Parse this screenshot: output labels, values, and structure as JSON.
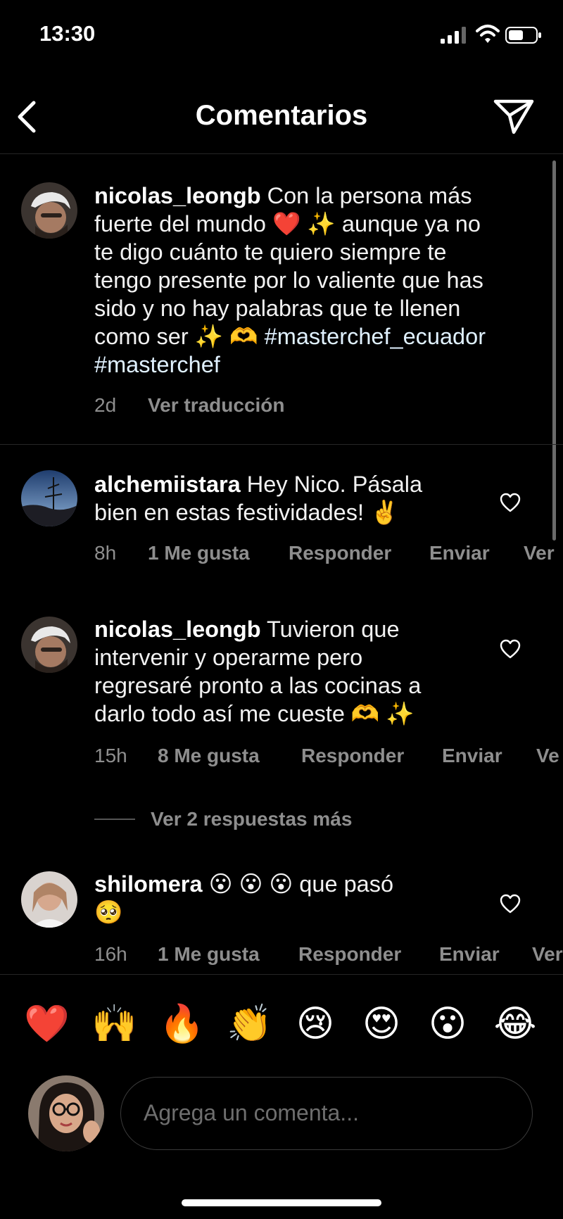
{
  "status_bar": {
    "time": "13:30"
  },
  "header": {
    "title": "Comentarios"
  },
  "caption": {
    "username": "nicolas_leongb",
    "text_lines": [
      "Con la persona más",
      "fuerte del mundo ❤️ ✨ aunque ya no",
      "te digo cuánto te quiero siempre te",
      "tengo presente por lo valiente que has",
      "sido y no hay palabras que te llenen",
      "como ser ✨ 🫶 "
    ],
    "hashtag_inline": "#masterchef_ecuador",
    "hashtag_next": "#masterchef",
    "time": "2d",
    "translate": "Ver traducción"
  },
  "comments": [
    {
      "username": "alchemiistara",
      "text_lines": [
        "Hey Nico. Pásala",
        "bien en estas festividades! ✌️"
      ],
      "time": "8h",
      "likes": "1 Me gusta",
      "reply": "Responder",
      "send": "Enviar",
      "more": "Ver"
    },
    {
      "username": "nicolas_leongb",
      "text_lines": [
        "Tuvieron que",
        "intervenir y operarme pero",
        "regresaré pronto a las cocinas a",
        "darlo todo así me cueste 🫶 ✨"
      ],
      "time": "15h",
      "likes": "8 Me gusta",
      "reply": "Responder",
      "send": "Enviar",
      "more": "Ve"
    },
    {
      "username": "shilomera",
      "text_lines": [
        "😮 😮 😮  que pasó",
        "🥺"
      ],
      "time": "16h",
      "likes": "1 Me gusta",
      "reply": "Responder",
      "send": "Enviar",
      "more": "Ver"
    }
  ],
  "view_replies": "Ver 2 respuestas más",
  "reactions": [
    "❤️",
    "🙌",
    "🔥",
    "👏",
    "😢",
    "😍",
    "😮",
    "😂"
  ],
  "compose": {
    "placeholder": "Agrega un comenta..."
  },
  "icons": [
    "signal-icon",
    "wifi-icon",
    "battery-icon",
    "back-arrow-icon",
    "direct-send-icon",
    "heart-icon"
  ],
  "colors": {
    "background": "#000000",
    "text": "#ffffff",
    "muted": "#8e8e8e",
    "hashtag": "#e0f1ff"
  }
}
